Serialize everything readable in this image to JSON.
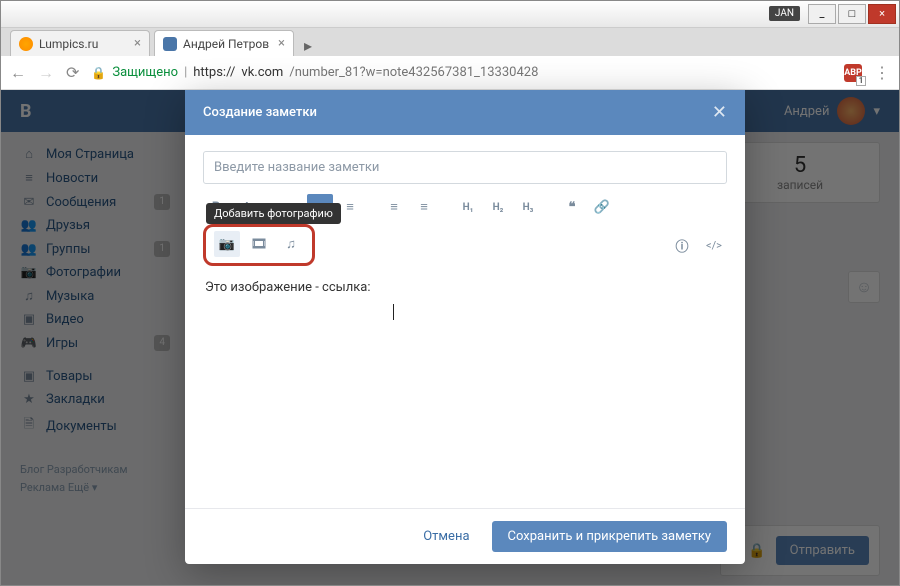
{
  "window": {
    "user_badge": "JAN",
    "min": "_",
    "max": "□",
    "close": "×"
  },
  "tabs": {
    "t1": "Lumpics.ru",
    "t2": "Андрей Петров"
  },
  "addr": {
    "back": "←",
    "fwd": "→",
    "reload": "⟳",
    "secure": "Защищено",
    "proto": "https://",
    "host": "vk.com",
    "path": "/number_81?w=note432567381_13330428",
    "ext": "ABP",
    "ext_badge": "1",
    "menu": "⋮"
  },
  "vk": {
    "logo": "B",
    "user": "Андрей",
    "drop": "▾"
  },
  "sidebar": {
    "items": [
      {
        "icon": "⌂",
        "label": "Моя Страница"
      },
      {
        "icon": "≡",
        "label": "Новости"
      },
      {
        "icon": "✉",
        "label": "Сообщения",
        "badge": "1"
      },
      {
        "icon": "👥",
        "label": "Друзья"
      },
      {
        "icon": "👥",
        "label": "Группы",
        "badge": "1"
      },
      {
        "icon": "📷",
        "label": "Фотографии"
      },
      {
        "icon": "♫",
        "label": "Музыка"
      },
      {
        "icon": "▣",
        "label": "Видео"
      },
      {
        "icon": "🎮",
        "label": "Игры",
        "badge": "4"
      },
      {
        "icon": "▣",
        "label": "Товары"
      },
      {
        "icon": "★",
        "label": "Закладки"
      },
      {
        "icon": "🗎",
        "label": "Документы"
      }
    ],
    "footer": "Блог  Разработчикам\nРеклама  Ещё ▾"
  },
  "right": {
    "count": "5",
    "count_label": "записей",
    "smile": "☺",
    "lock": "🔒",
    "send": "Отправить"
  },
  "modal": {
    "title": "Создание заметки",
    "close": "✕",
    "input_placeholder": "Введите название заметки",
    "tooltip": "Добавить фотографию",
    "content": "Это изображение - ссылка:",
    "cancel": "Отмена",
    "save": "Сохранить и прикрепить заметку",
    "tb": {
      "bold": "B",
      "italic": "I",
      "h1": "H₁",
      "h2": "H₂",
      "h3": "H₃",
      "quote": "❝",
      "link": "🔗",
      "info": "ⓘ",
      "code": "</>"
    }
  }
}
